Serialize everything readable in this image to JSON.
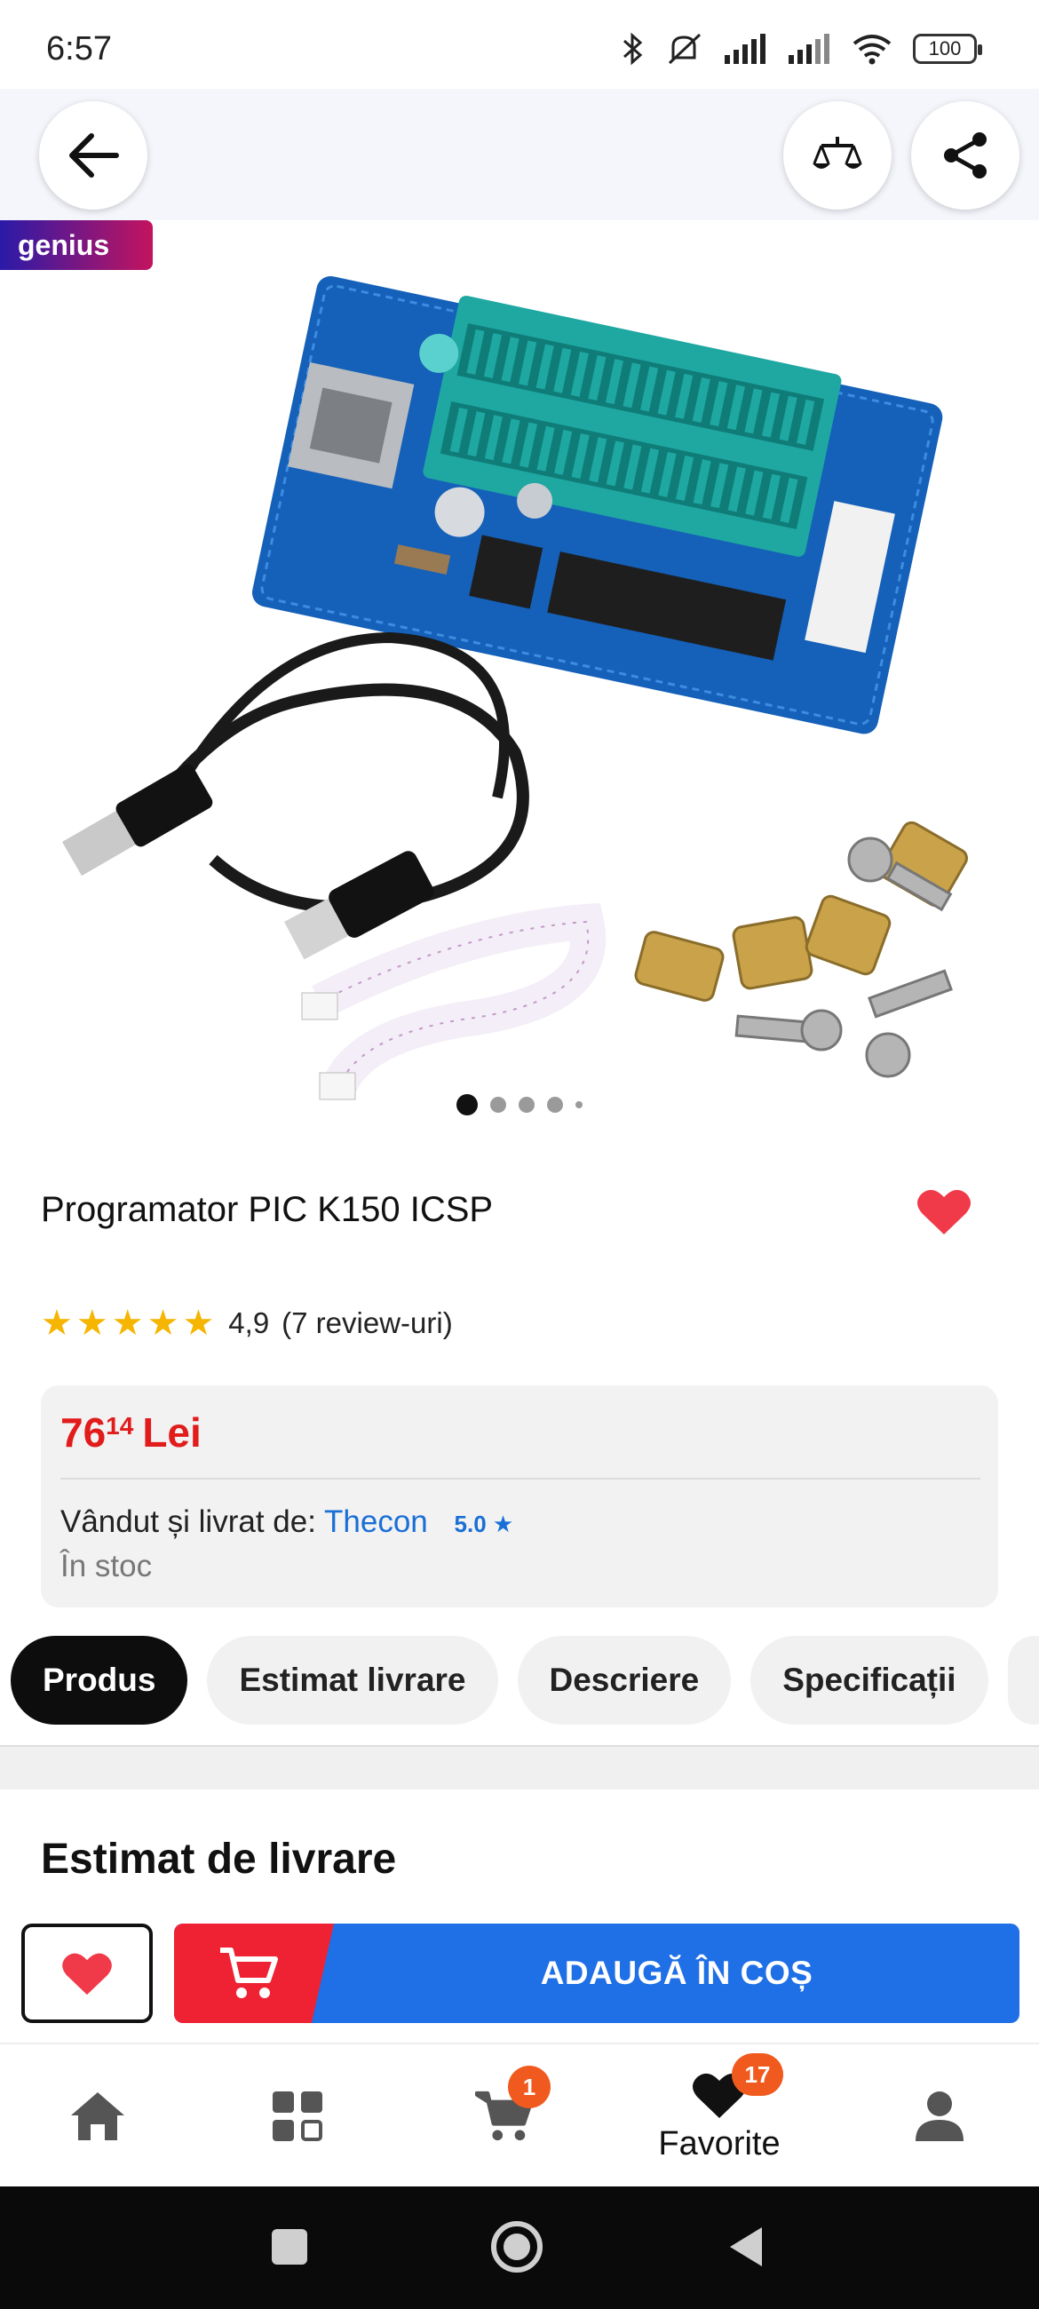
{
  "status_bar": {
    "time": "6:57",
    "battery": "100",
    "icons": [
      "bluetooth-icon",
      "mute-icon",
      "signal-icon",
      "signal-icon",
      "wifi-icon",
      "battery-icon"
    ]
  },
  "top_bar": {
    "back_icon": "arrow-left-icon",
    "compare_icon": "scale-compare-icon",
    "share_icon": "share-icon"
  },
  "gallery": {
    "badge": "genius",
    "dots": 5,
    "active_dot": 1
  },
  "product": {
    "title": "Programator PIC K150 ICSP",
    "rating": "4,9",
    "reviews": "(7 review-uri)",
    "stars": 5,
    "price_main": "76",
    "price_cents": "14",
    "currency": "Lei",
    "seller_label": "Vândut și livrat de:",
    "seller_name": "Thecon",
    "seller_score": "5.0",
    "stock": "În stoc"
  },
  "tabs": [
    "Produs",
    "Estimat livrare",
    "Descriere",
    "Specificații"
  ],
  "section": {
    "title": "Estimat de livrare"
  },
  "actions": {
    "add_to_cart": "ADAUGĂ ÎN COȘ"
  },
  "bottom_nav": {
    "cart_badge": "1",
    "favorites_badge": "17",
    "favorites_label": "Favorite"
  },
  "colors": {
    "price": "#e21b1b",
    "cart_blue": "#1f6fe6",
    "cart_red": "#ef2233",
    "link": "#1a6fd6",
    "badge": "#f15a1f"
  }
}
